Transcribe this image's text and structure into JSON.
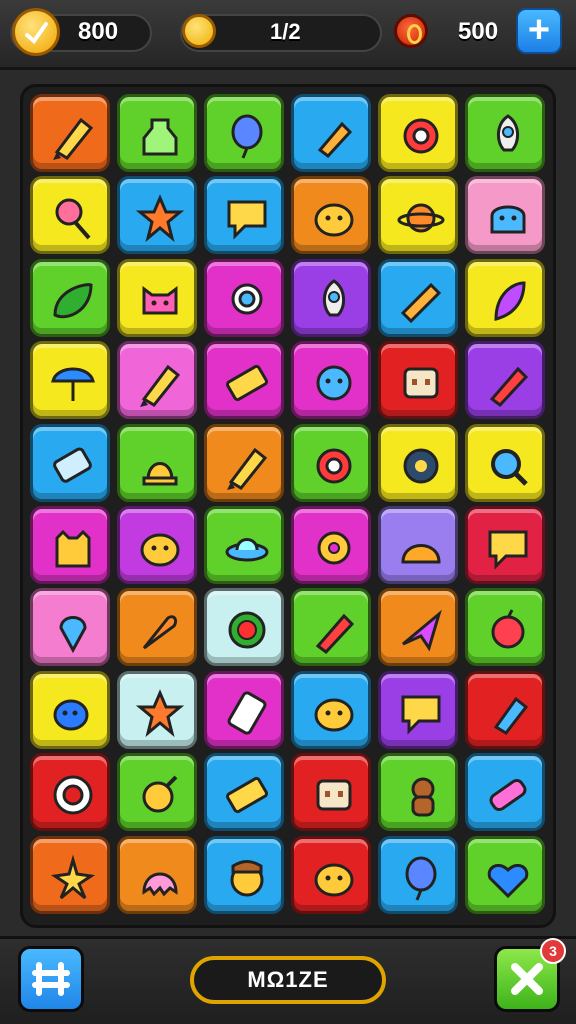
{
  "header": {
    "coins_value": "800",
    "level_progress": "1/2",
    "gems_value": "500",
    "coin_icon": "coin-icon",
    "sun_icon": "sun-coin-icon",
    "gem_icon": "red-gem-icon",
    "add_icon": "plus-icon"
  },
  "board": {
    "rows": 10,
    "cols": 6,
    "tiles": [
      {
        "color": "#f06a1c",
        "icon": "crayon-icon"
      },
      {
        "color": "#5fd12a",
        "icon": "bottle-icon"
      },
      {
        "color": "#5fd12a",
        "icon": "balloon-icon"
      },
      {
        "color": "#28a9f0",
        "icon": "paint-tube-icon"
      },
      {
        "color": "#f5e81e",
        "icon": "gear-icon"
      },
      {
        "color": "#5fd12a",
        "icon": "rocket-icon"
      },
      {
        "color": "#f5e81e",
        "icon": "lollipop-icon"
      },
      {
        "color": "#28a9f0",
        "icon": "star-icon"
      },
      {
        "color": "#28a9f0",
        "icon": "chat-bubble-icon"
      },
      {
        "color": "#f08a1c",
        "icon": "blob-face-icon"
      },
      {
        "color": "#f5e81e",
        "icon": "planet-icon"
      },
      {
        "color": "#f59ac8",
        "icon": "ghost-face-icon"
      },
      {
        "color": "#5fd12a",
        "icon": "leaf-icon"
      },
      {
        "color": "#f5e81e",
        "icon": "cat-face-icon"
      },
      {
        "color": "#e231c8",
        "icon": "ring-icon"
      },
      {
        "color": "#9a3ee6",
        "icon": "rocket-icon"
      },
      {
        "color": "#28a9f0",
        "icon": "candy-bar-icon"
      },
      {
        "color": "#f5e81e",
        "icon": "feather-icon"
      },
      {
        "color": "#f5e81e",
        "icon": "umbrella-icon"
      },
      {
        "color": "#f066d9",
        "icon": "crayon-icon"
      },
      {
        "color": "#e231c8",
        "icon": "battery-icon"
      },
      {
        "color": "#e231c8",
        "icon": "smiley-face-icon"
      },
      {
        "color": "#e22222",
        "icon": "robot-face-icon"
      },
      {
        "color": "#9a3ee6",
        "icon": "pencil-icon"
      },
      {
        "color": "#28a9f0",
        "icon": "cup-icon"
      },
      {
        "color": "#5fd12a",
        "icon": "bell-icon"
      },
      {
        "color": "#f08a1c",
        "icon": "crayon-icon"
      },
      {
        "color": "#5fd12a",
        "icon": "gear-icon"
      },
      {
        "color": "#f5e81e",
        "icon": "wreath-icon"
      },
      {
        "color": "#f5e81e",
        "icon": "magnifier-icon"
      },
      {
        "color": "#e231c8",
        "icon": "monster-icon"
      },
      {
        "color": "#c23be0",
        "icon": "blob-face-icon"
      },
      {
        "color": "#5fd12a",
        "icon": "ufo-icon"
      },
      {
        "color": "#e231c8",
        "icon": "donut-icon"
      },
      {
        "color": "#9a7ef0",
        "icon": "slime-face-icon"
      },
      {
        "color": "#e22245",
        "icon": "chat-bubble-icon"
      },
      {
        "color": "#f57dcf",
        "icon": "pin-icon"
      },
      {
        "color": "#f08a1c",
        "icon": "carrot-icon"
      },
      {
        "color": "#c8f0f0",
        "icon": "flower-icon"
      },
      {
        "color": "#5fd12a",
        "icon": "pencil-icon"
      },
      {
        "color": "#f08a1c",
        "icon": "jet-icon"
      },
      {
        "color": "#5fd12a",
        "icon": "apple-icon"
      },
      {
        "color": "#f5e81e",
        "icon": "bird-icon"
      },
      {
        "color": "#c8f0f0",
        "icon": "star-icon"
      },
      {
        "color": "#e231c8",
        "icon": "phone-icon"
      },
      {
        "color": "#28a9f0",
        "icon": "blob-face-icon"
      },
      {
        "color": "#9a3ee6",
        "icon": "chat-bubble-icon"
      },
      {
        "color": "#e22222",
        "icon": "popsicle-icon"
      },
      {
        "color": "#e22222",
        "icon": "life-ring-icon"
      },
      {
        "color": "#5fd12a",
        "icon": "bulb-icon"
      },
      {
        "color": "#28a9f0",
        "icon": "battery-icon"
      },
      {
        "color": "#e22222",
        "icon": "robot-face-icon"
      },
      {
        "color": "#5fd12a",
        "icon": "bear-icon"
      },
      {
        "color": "#28a9f0",
        "icon": "eraser-icon"
      },
      {
        "color": "#f06a1c",
        "icon": "star-shape-icon"
      },
      {
        "color": "#f08a1c",
        "icon": "octopus-icon"
      },
      {
        "color": "#28a9f0",
        "icon": "face-icon"
      },
      {
        "color": "#e22222",
        "icon": "blob-face-icon"
      },
      {
        "color": "#28a9f0",
        "icon": "balloon-icon"
      },
      {
        "color": "#5fd12a",
        "icon": "heart-icon"
      }
    ]
  },
  "footer": {
    "mode_label": "MΩ1ZE",
    "left_icon": "grid-icon",
    "right_icon": "close-icon",
    "notification_count": "3"
  }
}
